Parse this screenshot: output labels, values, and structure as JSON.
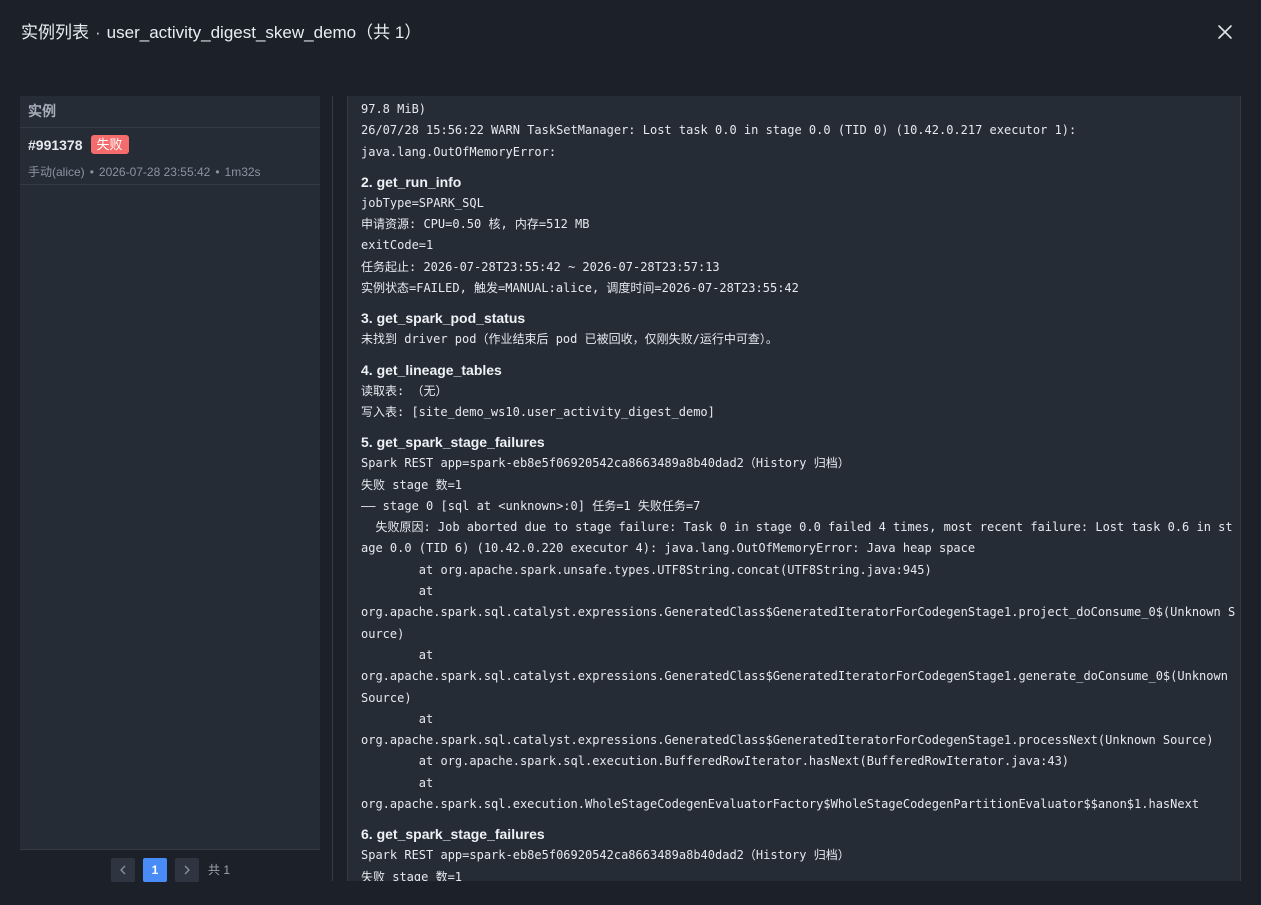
{
  "header": {
    "title_prefix": "实例列表",
    "separator": "·",
    "job_name": "user_activity_digest_skew_demo",
    "count_label": "（共 1）"
  },
  "left_panel": {
    "heading": "实例",
    "instances": [
      {
        "id": "#991378",
        "status": "失败",
        "trigger": "手动(alice)",
        "time": "2026-07-28 23:55:42",
        "duration": "1m32s"
      }
    ]
  },
  "pagination": {
    "prev_icon": "chevron-left-icon",
    "current_page": "1",
    "next_icon": "chevron-right-icon",
    "total_label": "共 1"
  },
  "log": {
    "intro_lines": [
      "97.8 MiB)",
      "26/07/28 15:56:22 WARN TaskSetManager: Lost task 0.0 in stage 0.0 (TID 0) (10.42.0.217 executor 1):",
      "java.lang.OutOfMemoryError:"
    ],
    "sections": [
      {
        "title": "2. get_run_info",
        "lines": [
          "jobType=SPARK_SQL",
          "申请资源: CPU=0.50 核, 内存=512 MB",
          "exitCode=1",
          "任务起止: 2026-07-28T23:55:42 ~ 2026-07-28T23:57:13",
          "实例状态=FAILED, 触发=MANUAL:alice, 调度时间=2026-07-28T23:55:42"
        ]
      },
      {
        "title": "3. get_spark_pod_status",
        "lines": [
          "未找到 driver pod（作业结束后 pod 已被回收，仅刚失败/运行中可查）。"
        ]
      },
      {
        "title": "4. get_lineage_tables",
        "lines": [
          "读取表: （无）",
          "写入表: [site_demo_ws10.user_activity_digest_demo]"
        ]
      },
      {
        "title": "5. get_spark_stage_failures",
        "lines": [
          "Spark REST app=spark-eb8e5f06920542ca8663489a8b40dad2（History 归档）",
          "失败 stage 数=1",
          "—— stage 0 [sql at <unknown>:0] 任务=1 失败任务=7",
          "  失败原因: Job aborted due to stage failure: Task 0 in stage 0.0 failed 4 times, most recent failure: Lost task 0.6 in stage 0.0 (TID 6) (10.42.0.220 executor 4): java.lang.OutOfMemoryError: Java heap space",
          "        at org.apache.spark.unsafe.types.UTF8String.concat(UTF8String.java:945)",
          "        at",
          "org.apache.spark.sql.catalyst.expressions.GeneratedClass$GeneratedIteratorForCodegenStage1.project_doConsume_0$(Unknown Source)",
          "        at",
          "org.apache.spark.sql.catalyst.expressions.GeneratedClass$GeneratedIteratorForCodegenStage1.generate_doConsume_0$(Unknown Source)",
          "        at",
          "org.apache.spark.sql.catalyst.expressions.GeneratedClass$GeneratedIteratorForCodegenStage1.processNext(Unknown Source)",
          "        at org.apache.spark.sql.execution.BufferedRowIterator.hasNext(BufferedRowIterator.java:43)",
          "        at",
          "org.apache.spark.sql.execution.WholeStageCodegenEvaluatorFactory$WholeStageCodegenPartitionEvaluator$$anon$1.hasNext"
        ]
      },
      {
        "title": "6. get_spark_stage_failures",
        "lines": [
          "Spark REST app=spark-eb8e5f06920542ca8663489a8b40dad2（History 归档）",
          "失败 stage 数=1"
        ]
      }
    ]
  },
  "colors": {
    "background": "#1c2129",
    "panel": "#262c36",
    "failed_badge": "#f56c6c",
    "active_page": "#4a8cf7"
  }
}
